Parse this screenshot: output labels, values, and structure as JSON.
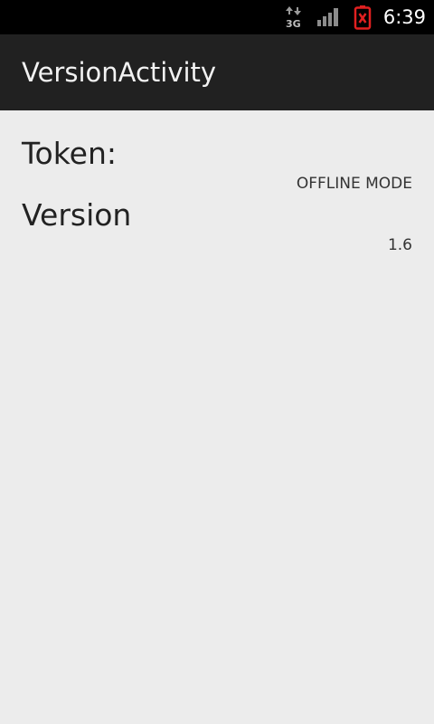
{
  "status_bar": {
    "network_type": "3G",
    "network_icon": "data-3g-icon",
    "signal_icon": "signal-strength-icon",
    "battery_icon": "battery-empty-icon",
    "battery_color": "#e02020",
    "time": "6:39"
  },
  "action_bar": {
    "title": "VersionActivity"
  },
  "content": {
    "token_label": "Token:",
    "token_value": "OFFLINE MODE",
    "version_label": "Version",
    "version_value": "1.6"
  }
}
